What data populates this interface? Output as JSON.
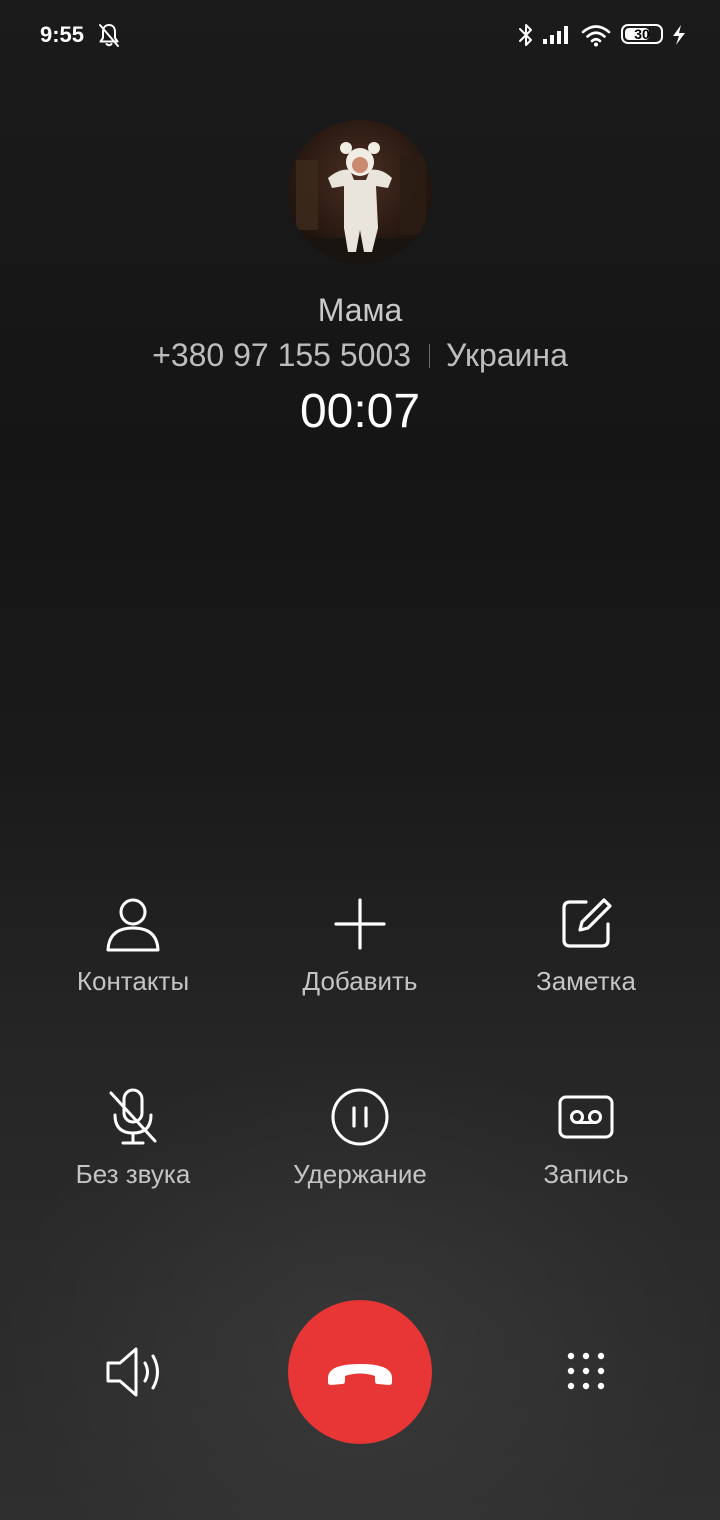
{
  "status_bar": {
    "time": "9:55",
    "battery_level": "30",
    "icons": [
      "bell-off-icon",
      "bluetooth-icon",
      "signal-icon",
      "wifi-icon",
      "battery-icon",
      "charging-icon"
    ]
  },
  "caller": {
    "name": "Мама",
    "number": "+380 97 155 5003",
    "location": "Украина",
    "duration": "00:07"
  },
  "actions": {
    "contacts": {
      "label": "Контакты",
      "icon": "person-icon"
    },
    "add": {
      "label": "Добавить",
      "icon": "plus-icon"
    },
    "note": {
      "label": "Заметка",
      "icon": "edit-note-icon"
    },
    "mute": {
      "label": "Без звука",
      "icon": "mic-off-icon"
    },
    "hold": {
      "label": "Удержание",
      "icon": "pause-icon"
    },
    "record": {
      "label": "Запись",
      "icon": "record-icon"
    }
  },
  "bottom": {
    "speaker_icon": "speaker-icon",
    "end_call_icon": "hang-up-icon",
    "keypad_icon": "dialpad-icon"
  },
  "colors": {
    "end_call": "#e83535",
    "text_primary": "#ffffff",
    "text_secondary": "#c4c4c4"
  }
}
